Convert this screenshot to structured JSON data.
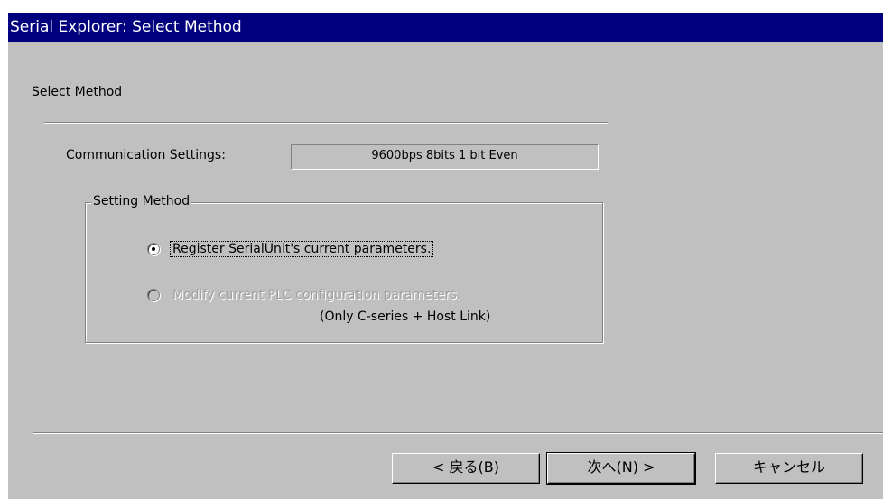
{
  "window": {
    "title": "Serial Explorer: Select Method"
  },
  "page": {
    "section_title": "Select Method"
  },
  "communication": {
    "label": "Communication Settings:",
    "value": "9600bps 8bits 1 bit Even"
  },
  "setting_method": {
    "group_label": "Setting Method",
    "options": [
      {
        "label": "Register SerialUnit's current parameters.",
        "selected": true,
        "enabled": true
      },
      {
        "label": "Modify current PLC configuration parameters.",
        "note": "(Only C-series + Host Link)",
        "selected": false,
        "enabled": false
      }
    ]
  },
  "buttons": {
    "back": "< 戻る(B)",
    "next": "次へ(N) >",
    "cancel": "キャンセル"
  },
  "colors": {
    "titlebar": "#00007f",
    "face": "#c0c0c0",
    "disabled_text": "#a0a0a0"
  }
}
